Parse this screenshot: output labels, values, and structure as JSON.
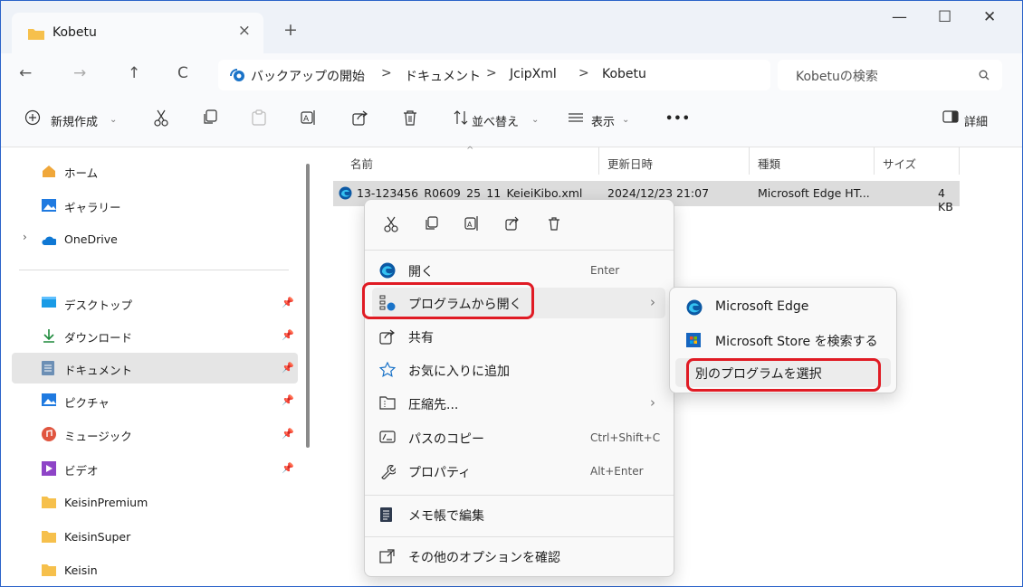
{
  "window": {
    "tab_title": "Kobetu",
    "tab_close": "×",
    "new_tab": "+",
    "minimize": "—",
    "maximize": "☐",
    "close": "✕"
  },
  "nav": {
    "back": "←",
    "forward": "→",
    "up": "↑",
    "refresh": "C",
    "breadcrumbs": [
      "バックアップの開始",
      "ドキュメント",
      "JcipXml",
      "Kobetu"
    ],
    "separator": ">",
    "search_placeholder": "Kobetuの検索"
  },
  "toolbar": {
    "new_label": "新規作成",
    "sort_label": "並べ替え",
    "view_label": "表示",
    "more_label": "•••",
    "details_label": "詳細"
  },
  "sidebar": {
    "items": [
      {
        "label": "ホーム",
        "icon": "home-icon"
      },
      {
        "label": "ギャラリー",
        "icon": "gallery-icon"
      },
      {
        "label": "OneDrive",
        "icon": "onedrive-icon"
      },
      {
        "label": "デスクトップ",
        "icon": "desktop-icon"
      },
      {
        "label": "ダウンロード",
        "icon": "download-icon"
      },
      {
        "label": "ドキュメント",
        "icon": "documents-icon"
      },
      {
        "label": "ピクチャ",
        "icon": "pictures-icon"
      },
      {
        "label": "ミュージック",
        "icon": "music-icon"
      },
      {
        "label": "ビデオ",
        "icon": "video-icon"
      },
      {
        "label": "KeisinPremium",
        "icon": "folder-icon"
      },
      {
        "label": "KeisinSuper",
        "icon": "folder-icon"
      },
      {
        "label": "Keisin",
        "icon": "folder-icon"
      }
    ]
  },
  "filelist": {
    "columns": [
      "名前",
      "更新日時",
      "種類",
      "サイズ"
    ],
    "rows": [
      {
        "name": "13-123456_R0609_25_11_KeieiKibo.xml",
        "modified": "2024/12/23 21:07",
        "type": "Microsoft Edge HT...",
        "size": "4 KB"
      }
    ]
  },
  "context_menu": {
    "items": [
      {
        "label": "開く",
        "shortcut": "Enter"
      },
      {
        "label": "プログラムから開く",
        "arrow": "›"
      },
      {
        "label": "共有"
      },
      {
        "label": "お気に入りに追加"
      },
      {
        "label": "圧縮先...",
        "arrow": "›"
      },
      {
        "label": "パスのコピー",
        "shortcut": "Ctrl+Shift+C"
      },
      {
        "label": "プロパティ",
        "shortcut": "Alt+Enter"
      },
      {
        "label": "メモ帳で編集"
      },
      {
        "label": "その他のオプションを確認"
      }
    ]
  },
  "submenu": {
    "items": [
      {
        "label": "Microsoft Edge"
      },
      {
        "label": "Microsoft Store を検索する"
      },
      {
        "label": "別のプログラムを選択"
      }
    ]
  },
  "colors": {
    "accent": "#0067c0",
    "highlight": "#e01b24",
    "selection": "#dcdcdc"
  }
}
